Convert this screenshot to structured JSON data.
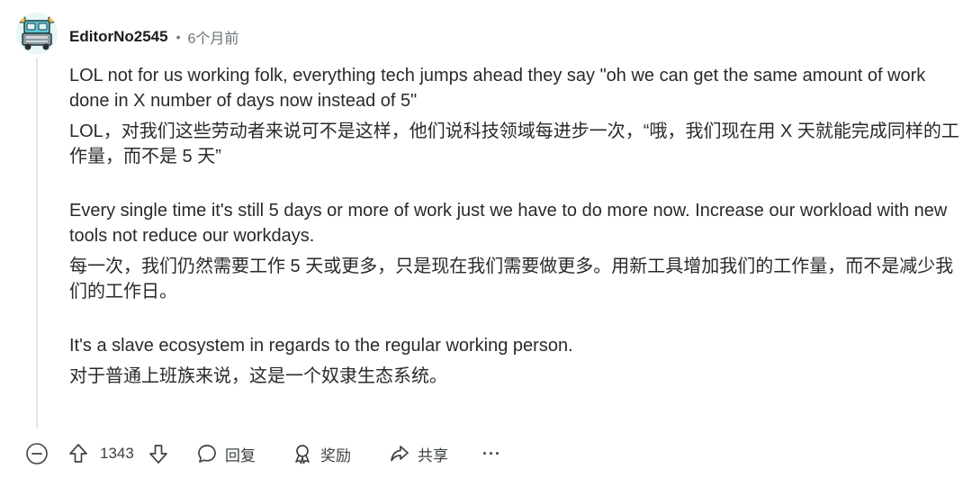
{
  "comment": {
    "author": "EditorNo2545",
    "separator": "•",
    "time": "6个月前",
    "paragraphs": [
      "LOL not for us working folk, everything tech jumps ahead they say \"oh we can get the same amount of work done in X number of days now instead of 5\"",
      "LOL，对我们这些劳动者来说可不是这样，他们说科技领域每进步一次，“哦，我们现在用 X 天就能完成同样的工作量，而不是 5 天”",
      "Every single time it's still 5 days or more of work just we have to do more now. Increase our workload with new tools not reduce our workdays.",
      "每一次，我们仍然需要工作 5 天或更多，只是现在我们需要做更多。用新工具增加我们的工作量，而不是减少我们的工作日。",
      "It's a slave ecosystem in regards to the regular working person.",
      "对于普通上班族来说，这是一个奴隶生态系统。"
    ]
  },
  "actions": {
    "collapse_icon": "collapse-minus-icon",
    "score": "1343",
    "reply_label": "回复",
    "award_label": "奖励",
    "share_label": "共享",
    "more_label": "···"
  },
  "colors": {
    "text": "#2a2a2a",
    "meta": "#6b7379",
    "icon": "#3c4246",
    "thread_line": "#e5e5e5"
  }
}
